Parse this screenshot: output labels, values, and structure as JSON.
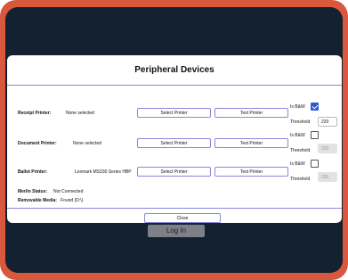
{
  "background": {
    "login_label": "Log In"
  },
  "modal": {
    "title": "Peripheral Devices",
    "select_label": "Select Printer",
    "test_label": "Test Printer",
    "is_bw_label": "Is B&W",
    "threshold_label": "Threshold",
    "printers": [
      {
        "label": "Receipt Printer:",
        "value": "None selected",
        "is_bw": true,
        "threshold": "220",
        "threshold_enabled": true
      },
      {
        "label": "Document Printer:",
        "value": "None selected",
        "is_bw": false,
        "threshold": "220",
        "threshold_enabled": false
      },
      {
        "label": "Ballot Printer:",
        "value": "Lexmark MS330 Series HBP",
        "is_bw": false,
        "threshold": "220",
        "threshold_enabled": false
      }
    ],
    "merlin_label": "Merlin Status:",
    "merlin_value": "Not Connected",
    "media_label": "Removable Media:",
    "media_value": "Found (D:\\)",
    "close_label": "Close"
  },
  "colors": {
    "frame": "#d9573c",
    "screen": "#142130",
    "accent": "#8a87d8",
    "checkbox": "#2f58d6"
  }
}
